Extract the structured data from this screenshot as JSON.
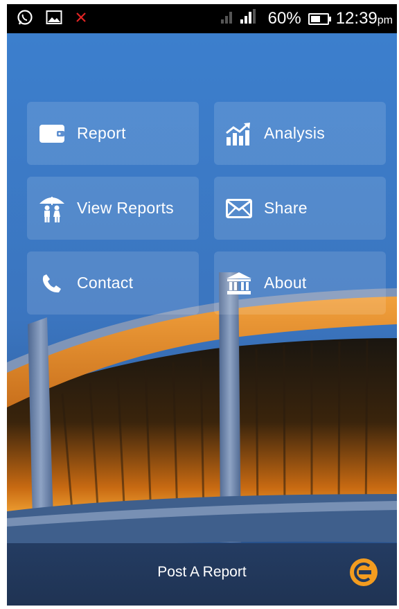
{
  "status_bar": {
    "battery_percent": "60%",
    "time": "12:39",
    "time_suffix": "pm",
    "icons": [
      "whatsapp-icon",
      "image-icon",
      "error-x-icon",
      "signal-icon",
      "battery-icon"
    ],
    "battery_level": 0.6
  },
  "menu": {
    "tiles": [
      {
        "label": "Report",
        "icon": "wallet-icon"
      },
      {
        "label": "Analysis",
        "icon": "chart-icon"
      },
      {
        "label": "View Reports",
        "icon": "family-umbrella-icon"
      },
      {
        "label": "Share",
        "icon": "envelope-icon"
      },
      {
        "label": "Contact",
        "icon": "phone-icon"
      },
      {
        "label": "About",
        "icon": "bank-icon"
      }
    ]
  },
  "bottom_bar": {
    "label": "Post A Report",
    "logo_icon": "app-logo-icon",
    "accent_color": "#f39c1f"
  },
  "colors": {
    "sky_top": "#3f82cf",
    "sky_bottom": "#1c3f76",
    "roof_orange": "#f4a23a"
  }
}
